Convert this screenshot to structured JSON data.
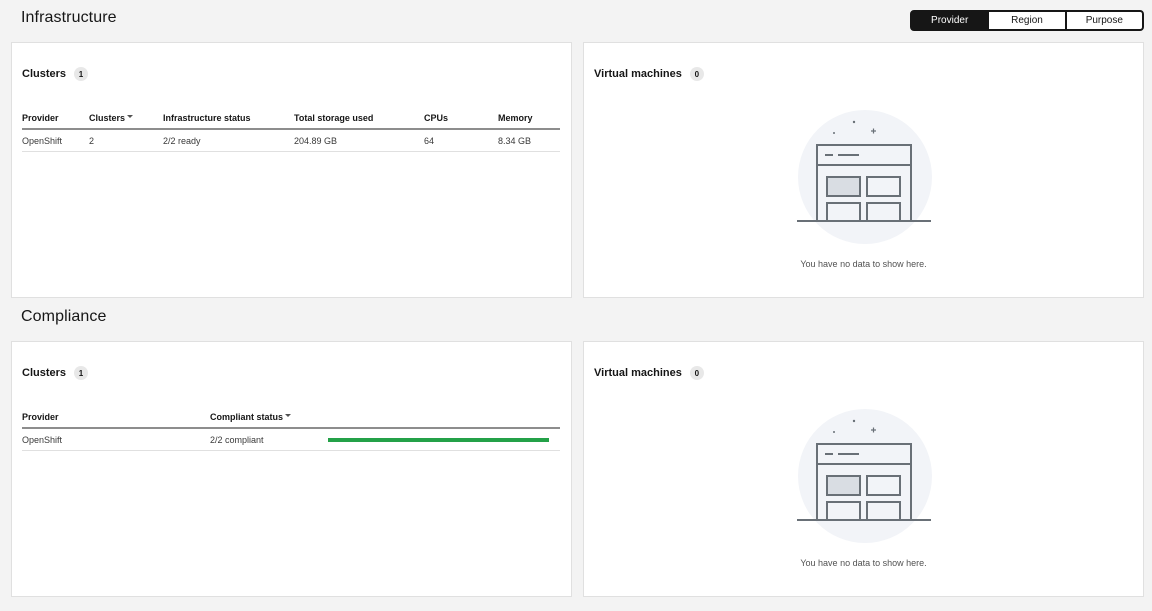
{
  "switcher": {
    "options": [
      "Provider",
      "Region",
      "Purpose"
    ],
    "selected": "Provider"
  },
  "infrastructure": {
    "title": "Infrastructure",
    "clusters": {
      "title": "Clusters",
      "count": "1",
      "columns": [
        "Provider",
        "Clusters",
        "Infrastructure status",
        "Total storage used",
        "CPUs",
        "Memory"
      ],
      "rows": [
        [
          "OpenShift",
          "2",
          "2/2 ready",
          "204.89 GB",
          "64",
          "8.34 GB"
        ]
      ]
    },
    "vms": {
      "title": "Virtual machines",
      "count": "0",
      "empty_text": "You have no data to show here."
    }
  },
  "compliance": {
    "title": "Compliance",
    "clusters": {
      "title": "Clusters",
      "count": "1",
      "columns": [
        "Provider",
        "Compliant status"
      ],
      "rows": [
        [
          "OpenShift",
          "2/2 compliant"
        ]
      ],
      "compliance_fraction": 1.0
    },
    "vms": {
      "title": "Virtual machines",
      "count": "0",
      "empty_text": "You have no data to show here."
    }
  },
  "colors": {
    "success": "#24a148",
    "background": "#f3f3f3",
    "card": "#ffffff"
  }
}
